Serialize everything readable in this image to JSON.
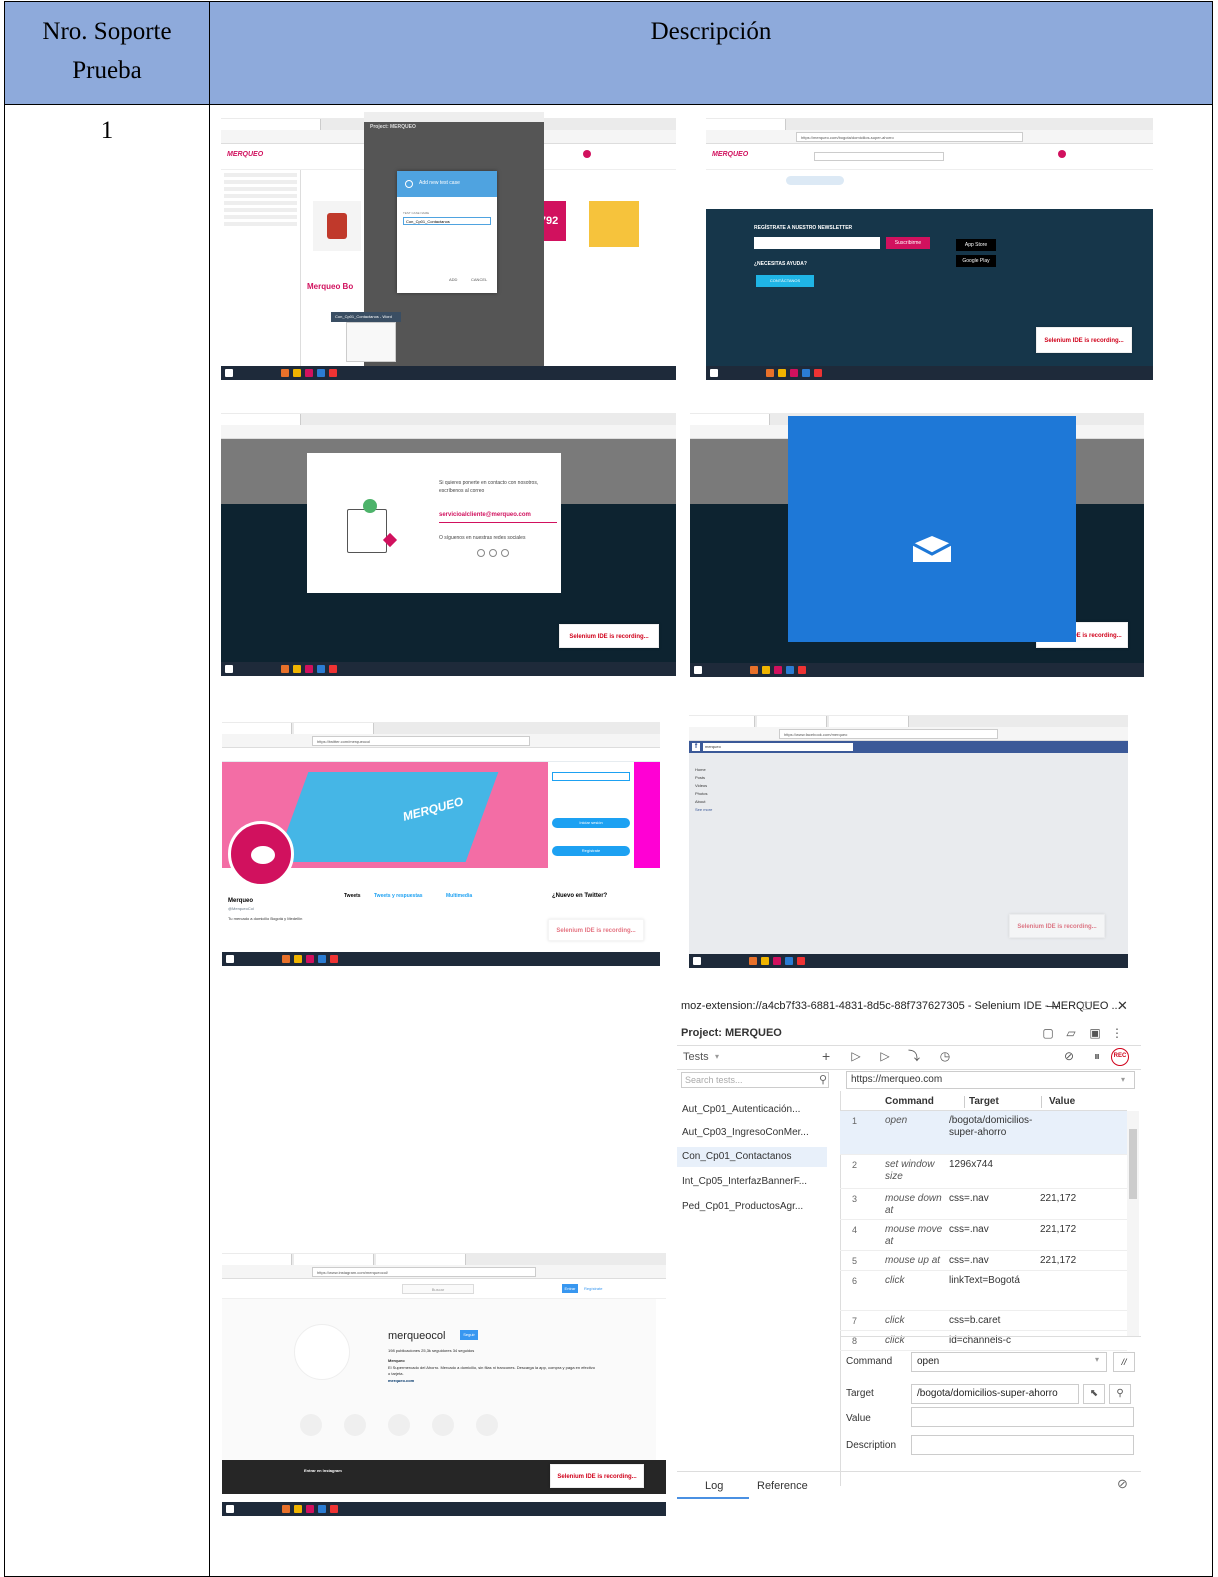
{
  "table": {
    "header_col1": "Nro. Soporte Prueba",
    "header_col2": "Descripción",
    "row_number": "1"
  },
  "shots": {
    "s1": {
      "dialog_title": "Add new test case",
      "dialog_label": "TEST CASE NAME",
      "dialog_value": "Con_Cp01_Contactanos",
      "add_label": "ADD",
      "cancel_label": "CANCEL",
      "project": "Project: MERQUEO",
      "taskbar_item": "Con_Cp01_Contactanos - Word",
      "brand": "Merqueo Bo"
    },
    "s2": {
      "url": "https://merqueo.com/bogota/domicilios-super-ahorro",
      "newsletter": "REGÍSTRATE A NUESTRO NEWSLETTER",
      "subscribe": "Suscribirme",
      "help": "¿NECESITAS AYUDA?",
      "contact": "CONTÁCTANOS",
      "app_store": "App Store",
      "google_play": "Google Play",
      "recording": "Selenium IDE is recording..."
    },
    "s3": {
      "modal_text": "Si quieres ponerte en contacto con nosotros, escríbenos al correo",
      "email": "servicioalcliente@merqueo.com",
      "social": "O síguenos en nuestras redes sociales",
      "recording": "Selenium IDE is recording..."
    },
    "s4": {
      "recording": "Selenium IDE is recording..."
    },
    "s5": {
      "url": "https://twitter.com/merqueocol",
      "name": "Merqueo",
      "handle": "@MerqueoCol",
      "bio": "Tu mercado a domicilio Bogotá y Medellín",
      "login_button": "Iniciar sesión",
      "signup_button": "Regístrate",
      "new_twitter": "¿Nuevo en Twitter?",
      "tweets_label": "Tweets",
      "tweets_tab2": "Tweets y respuestas",
      "tweets_tab3": "Multimedia",
      "recording": "Selenium IDE is recording..."
    },
    "s6": {
      "url": "https://www.facebook.com/merqueo",
      "search": "merqueo",
      "nav_items": [
        "Home",
        "Posts",
        "Videos",
        "Photos",
        "About",
        "See more"
      ],
      "recording": "Selenium IDE is recording..."
    },
    "s7": {
      "url": "https://www.instagram.com/merqueocol/",
      "search": "Buscar",
      "login": "Entrar",
      "signup": "Regístrate",
      "username": "merqueocol",
      "follow": "Seguir",
      "stats": "198 publicaciones   25,3k seguidores   34 seguidos",
      "bio_name": "Merqueo",
      "bio_text": "El Supermercado del Ahorro. Mercado a domicilio, sin filas ni trancones. Descarga la app, compra y paga en efectivo o tarjeta.",
      "bio_link": "merqueo.com",
      "login_prompt": "Entrar en Instagram",
      "recording": "Selenium IDE is recording..."
    }
  },
  "selenium": {
    "window_title": "moz-extension://a4cb7f33-6881-4831-8d5c-88f737627305 - Selenium IDE - MERQUEO ...",
    "minimize": "—",
    "maximize": "□",
    "close": "✕",
    "project": "Project:  MERQUEO",
    "tests_label": "Tests",
    "add_symbol": "+",
    "search_placeholder": "Search tests...",
    "base_url": "https://merqueo.com",
    "tests": [
      "Aut_Cp01_Autenticación...",
      "Aut_Cp03_IngresoConMer...",
      "Con_Cp01_Contactanos",
      "Int_Cp05_InterfazBannerF...",
      "Ped_Cp01_ProductosAgr..."
    ],
    "col_command": "Command",
    "col_target": "Target",
    "col_value": "Value",
    "rows": [
      {
        "n": "1",
        "command": "open",
        "target": "/bogota/domicilios-super-ahorro",
        "value": ""
      },
      {
        "n": "2",
        "command": "set window size",
        "target": "1296x744",
        "value": ""
      },
      {
        "n": "3",
        "command": "mouse down at",
        "target": "css=.nav",
        "value": "221,172"
      },
      {
        "n": "4",
        "command": "mouse move at",
        "target": "css=.nav",
        "value": "221,172"
      },
      {
        "n": "5",
        "command": "mouse up at",
        "target": "css=.nav",
        "value": "221,172"
      },
      {
        "n": "6",
        "command": "click",
        "target": "linkText=Bogotá",
        "value": ""
      },
      {
        "n": "7",
        "command": "click",
        "target": "css=b.caret",
        "value": ""
      },
      {
        "n": "8",
        "command": "click",
        "target": "id=channels-c",
        "value": ""
      }
    ],
    "editor": {
      "command_label": "Command",
      "command_value": "open",
      "comment_symbol": "//",
      "target_label": "Target",
      "target_value": "/bogota/domicilios-super-ahorro",
      "value_label": "Value",
      "description_label": "Description"
    },
    "tab_log": "Log",
    "tab_reference": "Reference",
    "rec_label": "REC"
  },
  "colors": {
    "header_bg": "#8eaadb",
    "merqueo_pink": "#d1115e",
    "footer_dark": "#16364a",
    "twitter_blue": "#1da1f2",
    "mail_blue": "#1e78d7",
    "facebook_blue": "#3b5998"
  }
}
